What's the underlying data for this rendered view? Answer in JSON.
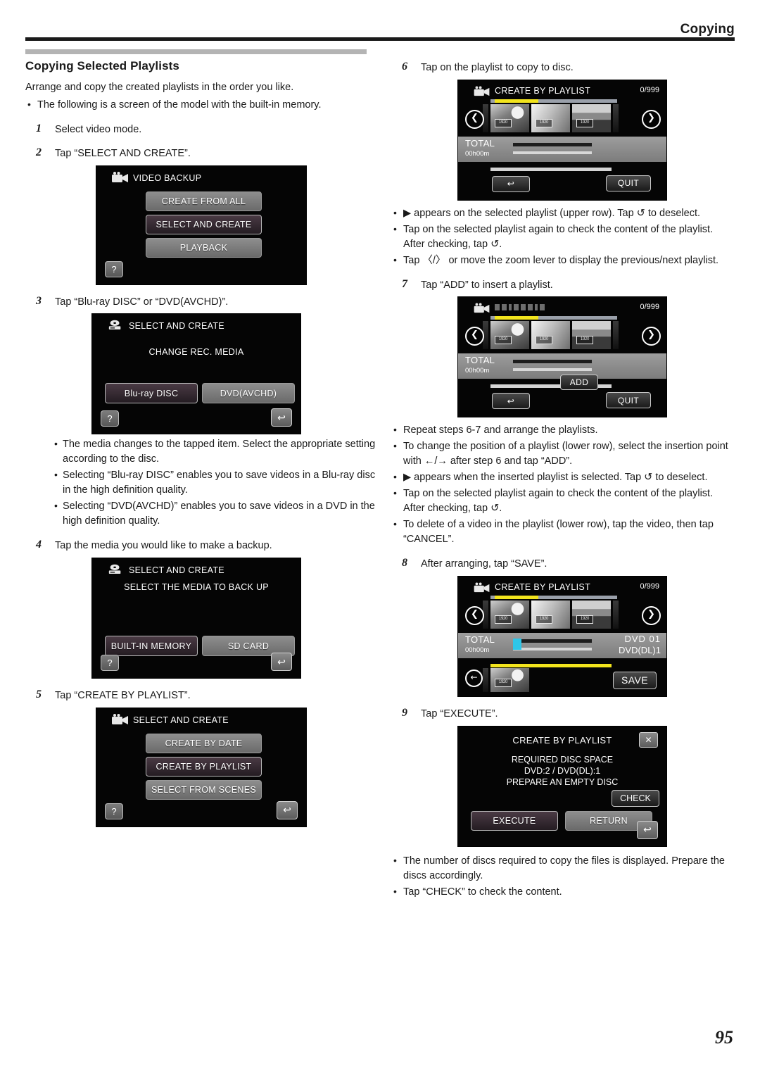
{
  "header": {
    "title": "Copying"
  },
  "page_number": "95",
  "section": {
    "title": "Copying Selected Playlists",
    "intro": "Arrange and copy the created playlists in the order you like.",
    "intro_bullets": [
      "The following is a screen of the model with the built-in memory."
    ]
  },
  "steps": {
    "s1": {
      "num": "1",
      "text": "Select video mode."
    },
    "s2": {
      "num": "2",
      "text": "Tap “SELECT AND CREATE”."
    },
    "s3": {
      "num": "3",
      "text": "Tap “Blu-ray DISC” or “DVD(AVCHD)”."
    },
    "s4": {
      "num": "4",
      "text": "Tap the media you would like to make a backup."
    },
    "s5": {
      "num": "5",
      "text": "Tap “CREATE BY PLAYLIST”."
    },
    "s6": {
      "num": "6",
      "text": "Tap on the playlist to copy to disc."
    },
    "s7": {
      "num": "7",
      "text": "Tap “ADD” to insert a playlist."
    },
    "s8": {
      "num": "8",
      "text": "After arranging, tap “SAVE”."
    },
    "s9": {
      "num": "9",
      "text": "Tap “EXECUTE”."
    }
  },
  "bullets_after_step3": [
    "The media changes to the tapped item. Select the appropriate setting according to the disc.",
    "Selecting “Blu-ray DISC” enables you to save videos in a Blu-ray disc in the high definition quality.",
    "Selecting “DVD(AVCHD)” enables you to save videos in a DVD in the high definition quality."
  ],
  "bullets_after_step6": [
    "▶ appears on the selected playlist (upper row). Tap ↺ to deselect.",
    "Tap on the selected playlist again to check the content of the playlist. After checking, tap ↺.",
    "Tap 〈/〉 or move the zoom lever to display the previous/next playlist."
  ],
  "bullets_after_step7": [
    "Repeat steps 6-7 and arrange the playlists.",
    "To change the position of a playlist (lower row), select the insertion point with ←/→ after step 6 and tap “ADD”.",
    "▶ appears when the inserted playlist is selected. Tap ↺ to deselect.",
    "Tap on the selected playlist again to check the content of the playlist. After checking, tap ↺.",
    "To delete of a video in the playlist (lower row), tap the video, then tap “CANCEL”."
  ],
  "bullets_after_step9": [
    "The number of discs required to copy the files is displayed. Prepare the discs accordingly.",
    "Tap “CHECK” to check the content."
  ],
  "screens": {
    "video_backup": {
      "icon": "camcorder-icon",
      "title": "VIDEO BACKUP",
      "buttons": [
        "CREATE FROM ALL",
        "SELECT AND CREATE",
        "PLAYBACK"
      ],
      "selected_index": 1,
      "help_label": "?"
    },
    "change_rec_media": {
      "icon": "disc-drive-icon",
      "title": "SELECT AND CREATE",
      "subtitle": "CHANGE REC. MEDIA",
      "buttons": [
        "Blu-ray DISC",
        "DVD(AVCHD)"
      ],
      "selected_index": 0,
      "help_label": "?",
      "back_label": "↩"
    },
    "select_media": {
      "icon": "disc-drive-icon",
      "title": "SELECT AND CREATE",
      "subtitle": "SELECT THE MEDIA TO BACK UP",
      "buttons": [
        "BUILT-IN MEMORY",
        "SD CARD"
      ],
      "selected_index": 0,
      "help_label": "?",
      "back_label": "↩"
    },
    "create_menu": {
      "icon": "camcorder-icon",
      "title": "SELECT AND CREATE",
      "buttons": [
        "CREATE BY DATE",
        "CREATE BY PLAYLIST",
        "SELECT FROM SCENES"
      ],
      "selected_index": 1,
      "help_label": "?",
      "back_label": "↩"
    },
    "playlist_step6": {
      "icon": "camcorder-icon",
      "title": "CREATE BY PLAYLIST",
      "count": "0/999",
      "total_label": "TOTAL",
      "total_time": "00h00m",
      "thumb_tags": [
        "1920",
        "1920",
        "1920"
      ],
      "buttons": [
        "QUIT"
      ],
      "back_label": "↩"
    },
    "playlist_step7": {
      "icon": "camcorder-icon",
      "title": "",
      "count": "0/999",
      "total_label": "TOTAL",
      "total_time": "00h00m",
      "thumb_tags": [
        "1920",
        "1920",
        "1920"
      ],
      "buttons": [
        "ADD",
        "QUIT"
      ],
      "back_label": "↩"
    },
    "playlist_step8": {
      "icon": "camcorder-icon",
      "title": "CREATE BY PLAYLIST",
      "count": "0/999",
      "total_label": "TOTAL",
      "total_time": "00h00m",
      "dvd_count": "DVD  01",
      "dvd_dl_count": "DVD(DL)1",
      "thumb_tags": [
        "1920",
        "1920",
        "1920"
      ],
      "lower_thumb_tag": "1920",
      "buttons": [
        "SAVE"
      ]
    },
    "disc_space": {
      "title": "CREATE BY PLAYLIST",
      "close_label": "✕",
      "line1": "REQUIRED DISC SPACE",
      "line2": "DVD:2 / DVD(DL):1",
      "line3": "PREPARE AN EMPTY DISC",
      "check_label": "CHECK",
      "buttons": [
        "EXECUTE",
        "RETURN"
      ],
      "selected_index": 0,
      "back_label": "↩"
    }
  },
  "colors": {
    "rule": "#1a1a1a",
    "section_bar": "#b4b4b4",
    "lcd_bg": "#050505",
    "accent_yellow": "#f2e41d",
    "accent_cyan": "#2fc6e8"
  }
}
